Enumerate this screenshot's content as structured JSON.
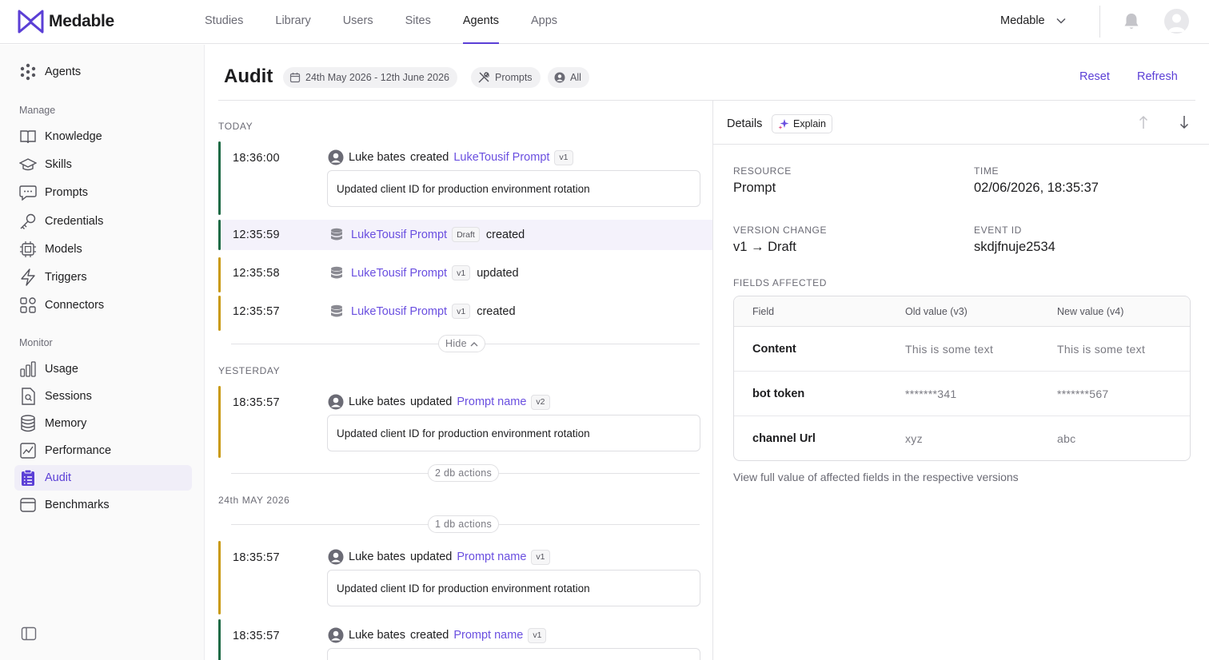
{
  "app": {
    "name": "Medable",
    "org": "Medable"
  },
  "nav": {
    "items": [
      {
        "label": "Studies"
      },
      {
        "label": "Library"
      },
      {
        "label": "Users"
      },
      {
        "label": "Sites"
      },
      {
        "label": "Agents",
        "active": true
      },
      {
        "label": "Apps"
      }
    ]
  },
  "sidebar": {
    "top": {
      "label": "Agents"
    },
    "manage_heading": "Manage",
    "manage": [
      {
        "label": "Knowledge",
        "icon": "book-icon"
      },
      {
        "label": "Skills",
        "icon": "graduation-cap-icon"
      },
      {
        "label": "Prompts",
        "icon": "chat-bubble-icon"
      },
      {
        "label": "Credentials",
        "icon": "key-icon"
      },
      {
        "label": "Models",
        "icon": "chip-icon"
      },
      {
        "label": "Triggers",
        "icon": "lightning-icon"
      },
      {
        "label": "Connectors",
        "icon": "blocks-icon"
      }
    ],
    "monitor_heading": "Monitor",
    "monitor": [
      {
        "label": "Usage",
        "icon": "bar-chart-icon"
      },
      {
        "label": "Sessions",
        "icon": "file-search-icon"
      },
      {
        "label": "Memory",
        "icon": "database-icon"
      },
      {
        "label": "Performance",
        "icon": "line-chart-icon"
      },
      {
        "label": "Audit",
        "icon": "clipboard-list-icon",
        "active": true
      },
      {
        "label": "Benchmarks",
        "icon": "archive-icon"
      }
    ]
  },
  "header": {
    "title": "Audit",
    "date_range": "24th May 2026 - 12th June 2026",
    "filter_type": "Prompts",
    "filter_user": "All",
    "reset": "Reset",
    "refresh": "Refresh"
  },
  "timeline": {
    "today_label": "TODAY",
    "today": [
      {
        "time": "18:36:00",
        "user": "Luke bates",
        "action": "created",
        "resource": "LukeTousif Prompt",
        "version": "v1",
        "message": "Updated client ID for production environment rotation",
        "bar_color": "#1f6b46"
      },
      {
        "time": "12:35:59",
        "resource": "LukeTousif Prompt",
        "version": "Draft",
        "action": "created",
        "bar_color": "#1f6b46",
        "selected": true
      },
      {
        "time": "12:35:58",
        "resource": "LukeTousif Prompt",
        "version": "v1",
        "action": "updated",
        "bar_color": "#c99a12"
      },
      {
        "time": "12:35:57",
        "resource": "LukeTousif Prompt",
        "version": "v1",
        "action": "created",
        "bar_color": "#c99a12"
      }
    ],
    "hide_label": "Hide",
    "yesterday_label": "YESTERDAY",
    "yesterday": [
      {
        "time": "18:35:57",
        "user": "Luke bates",
        "action": "updated",
        "resource": "Prompt name",
        "version": "v2",
        "message": "Updated client ID for production environment rotation",
        "bar_color": "#c99a12"
      }
    ],
    "yesterday_db_actions": "2 db actions",
    "older_label": "24th MAY 2026",
    "older_db_actions": "1 db actions",
    "older": [
      {
        "time": "18:35:57",
        "user": "Luke bates",
        "action": "updated",
        "resource": "Prompt name",
        "version": "v1",
        "message": "Updated client ID for production environment rotation",
        "bar_color": "#c99a12"
      },
      {
        "time": "18:35:57",
        "user": "Luke bates",
        "action": "created",
        "resource": "Prompt name",
        "version": "v1",
        "bar_color": "#1f6b46"
      }
    ]
  },
  "details": {
    "title": "Details",
    "explain": "Explain",
    "resource_label": "RESOURCE",
    "resource": "Prompt",
    "time_label": "TIME",
    "time": "02/06/2026, 18:35:37",
    "version_label": "VERSION CHANGE",
    "version_change": "v1 → Draft",
    "event_label": "EVENT ID",
    "event_id": "skdjfnuje2534",
    "fields_label": "FIELDS AFFECTED",
    "columns": [
      "Field",
      "Old value (v3)",
      "New value (v4)"
    ],
    "rows": [
      {
        "field": "Content",
        "old": "This is some text",
        "new": "This is some text"
      },
      {
        "field": "bot token",
        "old": "*******341",
        "new": "*******567"
      },
      {
        "field": "channel Url",
        "old": "xyz",
        "new": "abc"
      }
    ],
    "note": "View full value of affected fields in the respective versions"
  },
  "colors": {
    "accent": "#5b3fd6",
    "created": "#1f6b46",
    "updated": "#c99a12"
  }
}
